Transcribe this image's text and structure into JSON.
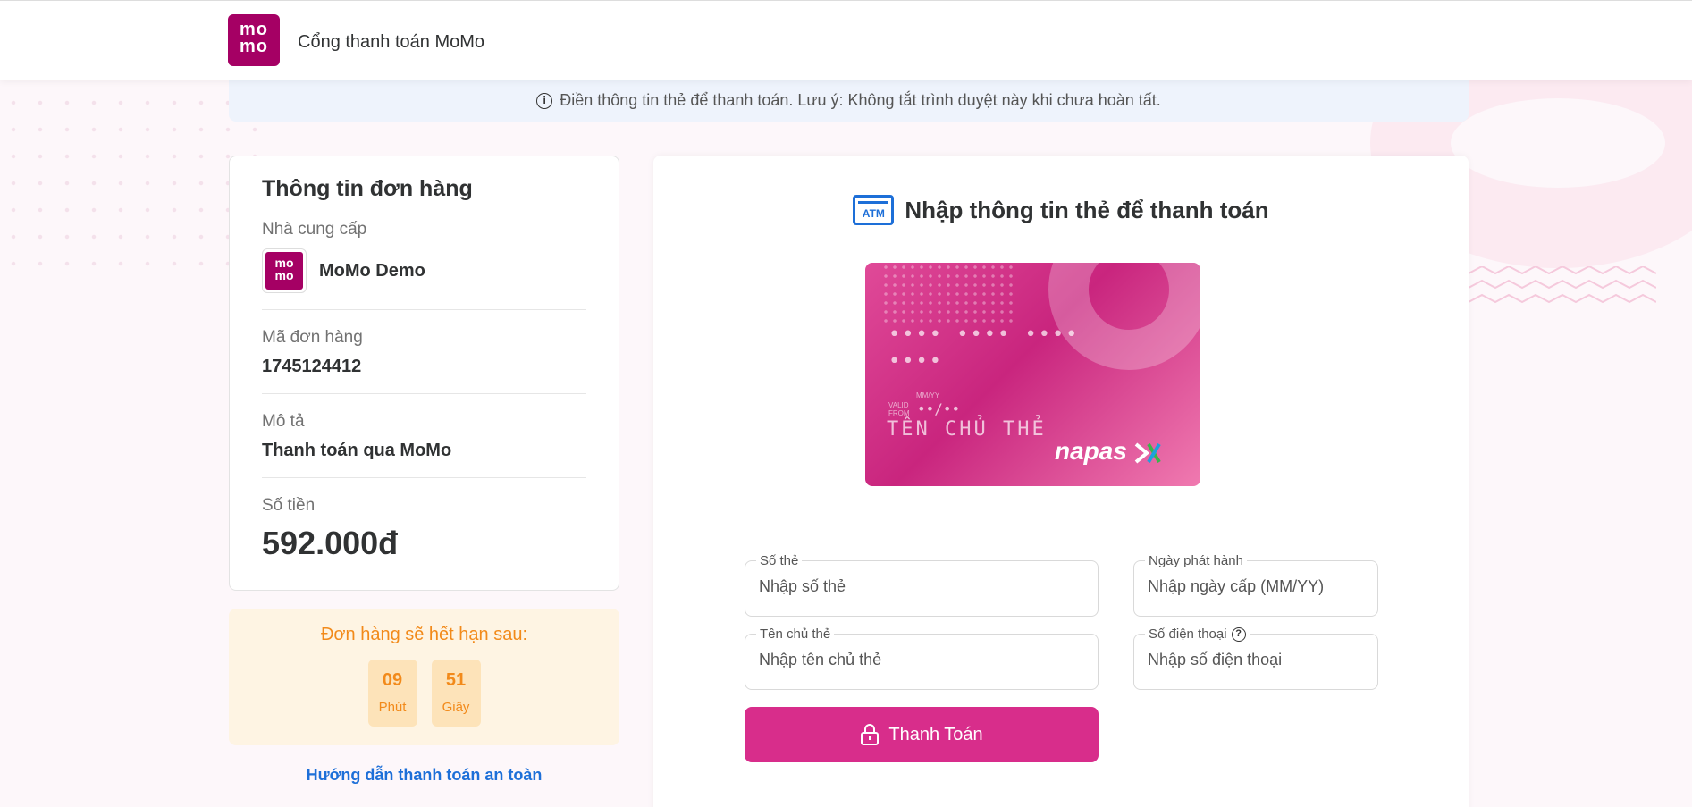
{
  "header": {
    "logo_text": "mo mo",
    "title": "Cổng thanh toán MoMo"
  },
  "notice": {
    "icon": "info-icon",
    "text": "Điền thông tin thẻ để thanh toán. Lưu ý: Không tắt trình duyệt này khi chưa hoàn tất."
  },
  "order": {
    "title": "Thông tin đơn hàng",
    "provider_label": "Nhà cung cấp",
    "provider_name": "MoMo Demo",
    "order_id_label": "Mã đơn hàng",
    "order_id": "1745124412",
    "desc_label": "Mô tả",
    "desc": "Thanh toán qua MoMo",
    "amount_label": "Số tiền",
    "amount": "592.000đ"
  },
  "expiry": {
    "title": "Đơn hàng sẽ hết hạn sau:",
    "minutes": "09",
    "minutes_label": "Phút",
    "seconds": "51",
    "seconds_label": "Giây"
  },
  "safe_link": "Hướng dẫn thanh toán an toàn",
  "payment": {
    "title": "Nhập thông tin thẻ để thanh toán",
    "atm_label": "ATM",
    "card": {
      "number_mask": "•••• •••• •••• ••••",
      "valid_from": "VALID FROM",
      "mmyy": "MM/YY",
      "expiry_mask": "••/••",
      "holder": "TÊN CHỦ THẺ",
      "brand": "napas"
    },
    "fields": {
      "card_number": {
        "label": "Số thẻ",
        "placeholder": "Nhập số thẻ"
      },
      "issue_date": {
        "label": "Ngày phát hành",
        "placeholder": "Nhập ngày cấp (MM/YY)"
      },
      "holder_name": {
        "label": "Tên chủ thẻ",
        "placeholder": "Nhập tên chủ thẻ"
      },
      "phone": {
        "label": "Số điện thoại",
        "placeholder": "Nhập số điện thoại"
      }
    },
    "pay_button": "Thanh Toán"
  },
  "colors": {
    "brand": "#a50064",
    "button": "#d82d8b",
    "link": "#1d6fd8",
    "timer": "#f28a1a"
  }
}
